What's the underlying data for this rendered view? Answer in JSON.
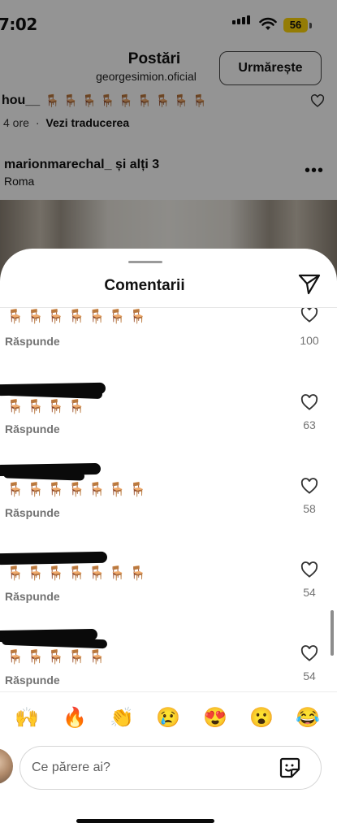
{
  "status_bar": {
    "time": "7:02",
    "battery": "56"
  },
  "post_header": {
    "title": "Postări",
    "account": "georgesimion.oficial",
    "follow_label": "Urmărește"
  },
  "background_comment": {
    "username": "hou__",
    "chairs": "🪑🪑🪑🪑🪑🪑🪑🪑🪑",
    "age": "4 ore",
    "separator": "·",
    "translate": "Vezi traducerea"
  },
  "background_location": {
    "users": "marionmarechal_ și alți 3",
    "place": "Roma"
  },
  "sheet": {
    "title": "Comentarii"
  },
  "comments": [
    {
      "chairs": "🪑🪑🪑🪑🪑🪑🪑",
      "reply": "Răspunde",
      "likes": "100"
    },
    {
      "chairs": "🪑🪑🪑🪑",
      "reply": "Răspunde",
      "likes": "63"
    },
    {
      "chairs": "🪑🪑🪑🪑🪑🪑🪑",
      "reply": "Răspunde",
      "likes": "58"
    },
    {
      "chairs": "🪑🪑🪑🪑🪑🪑🪑",
      "reply": "Răspunde",
      "likes": "54"
    },
    {
      "chairs": "🪑🪑🪑🪑🪑",
      "reply": "Răspunde",
      "likes": "54"
    }
  ],
  "emoji_reactions": [
    "🙌",
    "🔥",
    "👏",
    "😢",
    "😍",
    "😮",
    "😂"
  ],
  "composer": {
    "placeholder": "Ce părere ai?"
  },
  "icons": {
    "share": "paper-plane-icon",
    "like": "heart-outline-icon",
    "sticker": "sticker-icon",
    "more": "more-horizontal-icon"
  },
  "colors": {
    "battery": "#ffd60a",
    "muted_text": "#737373",
    "overlay": "rgba(0,0,0,0.42)"
  }
}
